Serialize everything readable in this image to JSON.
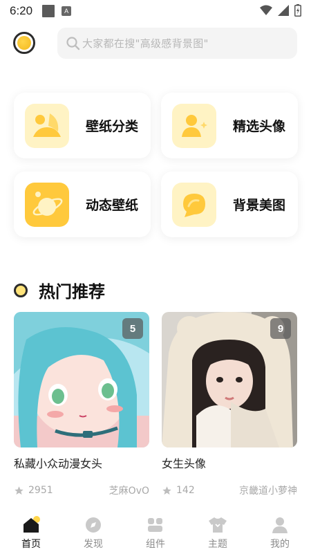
{
  "status_bar": {
    "time": "6:20",
    "app_badge": "A"
  },
  "header": {
    "search_placeholder": "大家都在搜\"高级感背景图\""
  },
  "categories": [
    {
      "label": "壁纸分类",
      "icon": "wallpaper-category-icon"
    },
    {
      "label": "精选头像",
      "icon": "avatar-icon"
    },
    {
      "label": "动态壁纸",
      "icon": "planet-icon"
    },
    {
      "label": "背景美图",
      "icon": "chat-bubble-icon"
    }
  ],
  "section": {
    "title": "热门推荐"
  },
  "recommend": [
    {
      "title": "私藏小众动漫女头",
      "count": "5",
      "likes": "2951",
      "author": "芝麻OvO"
    },
    {
      "title": "女生头像",
      "count": "9",
      "likes": "142",
      "author": "京畿道小萝神"
    }
  ],
  "nav": [
    {
      "label": "首页",
      "icon": "home-icon",
      "active": true
    },
    {
      "label": "发现",
      "icon": "discover-icon",
      "active": false
    },
    {
      "label": "组件",
      "icon": "widget-icon",
      "active": false
    },
    {
      "label": "主题",
      "icon": "theme-shirt-icon",
      "active": false
    },
    {
      "label": "我的",
      "icon": "profile-icon",
      "active": false
    }
  ],
  "colors": {
    "accent_yellow": "#FFD54A",
    "icon_bg_light": "#FFF3C4",
    "icon_fg": "#FFC93C"
  }
}
